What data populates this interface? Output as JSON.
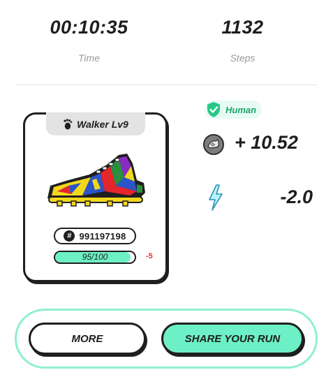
{
  "stats": {
    "time": {
      "value": "00:10:35",
      "label": "Time"
    },
    "steps": {
      "value": "1132",
      "label": "Steps"
    }
  },
  "card": {
    "tab_icon": "footprint-icon",
    "level_label": "Walker Lv9",
    "sneaker_id": "991197198",
    "durability": {
      "text": "95/100",
      "current": 95,
      "max": 100
    },
    "durability_delta": "-5"
  },
  "mode_badge": {
    "label": "Human",
    "icon": "shield-check-icon",
    "color": "#1aa56e"
  },
  "reward": {
    "icon": "gst-coin-icon",
    "value": "+ 10.52"
  },
  "energy": {
    "icon": "lightning-bolt-icon",
    "value": "-2.0"
  },
  "actions": {
    "more_label": "MORE",
    "share_label": "SHARE YOUR RUN"
  },
  "colors": {
    "accent": "#6df0c6",
    "accent_border": "#8ff0cf",
    "negative": "#ee2a2a"
  }
}
